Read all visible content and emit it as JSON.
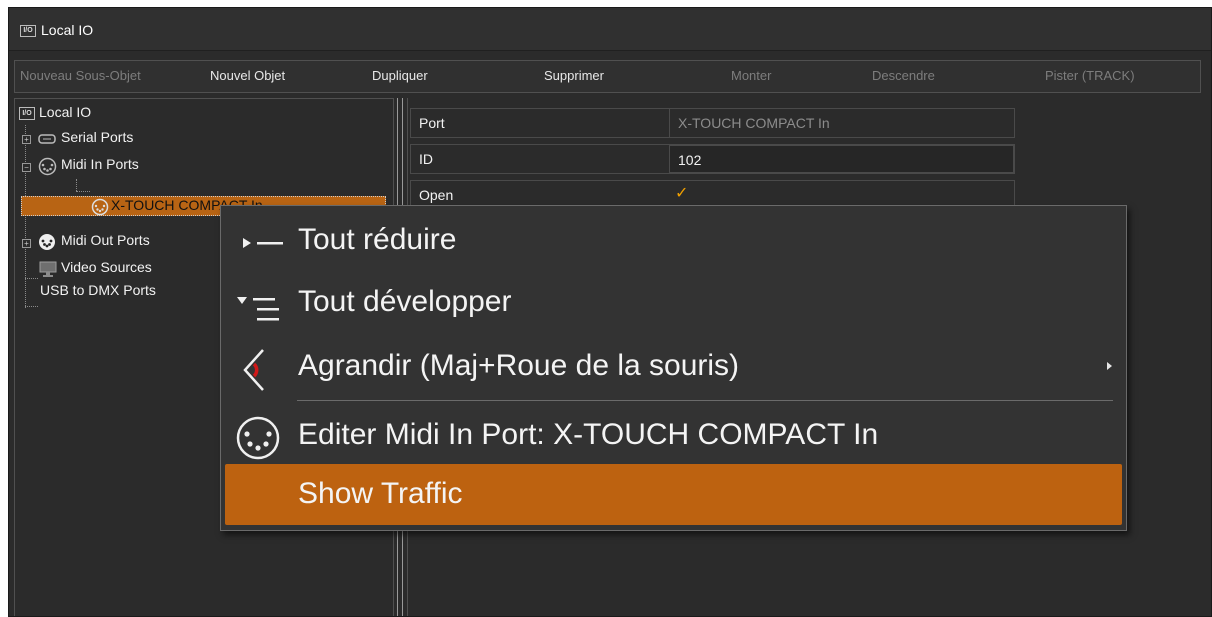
{
  "window": {
    "title": "Local IO",
    "title_icon": "I/O"
  },
  "toolbar": {
    "new_sub_object": "Nouveau Sous-Objet",
    "new_object": "Nouvel Objet",
    "duplicate": "Dupliquer",
    "delete": "Supprimer",
    "move_up": "Monter",
    "move_down": "Descendre",
    "track": "Pister (TRACK)"
  },
  "tree": {
    "root": "Local IO",
    "root_icon": "I/O",
    "serial_ports": "Serial Ports",
    "midi_in_ports": "Midi In Ports",
    "selected_child": "X-TOUCH COMPACT In",
    "midi_out_ports": "Midi Out Ports",
    "video_sources": "Video Sources",
    "usb_dmx": "USB to DMX Ports"
  },
  "properties": {
    "rows": [
      {
        "key": "Port",
        "value": "X-TOUCH COMPACT In"
      },
      {
        "key": "ID",
        "value": "102"
      },
      {
        "key": "Open",
        "value": "checked"
      }
    ]
  },
  "context_menu": {
    "collapse_all": "Tout réduire",
    "expand_all": "Tout développer",
    "zoom": "Agrandir (Maj+Roue de la souris)",
    "edit_midi_port": "Editer Midi In Port: X-TOUCH COMPACT In",
    "show_traffic": "Show Traffic"
  },
  "colors": {
    "background": "#2b2b2b",
    "selection": "#b86414",
    "menu_highlight": "#bd6210",
    "checkmark": "#f0a000"
  }
}
